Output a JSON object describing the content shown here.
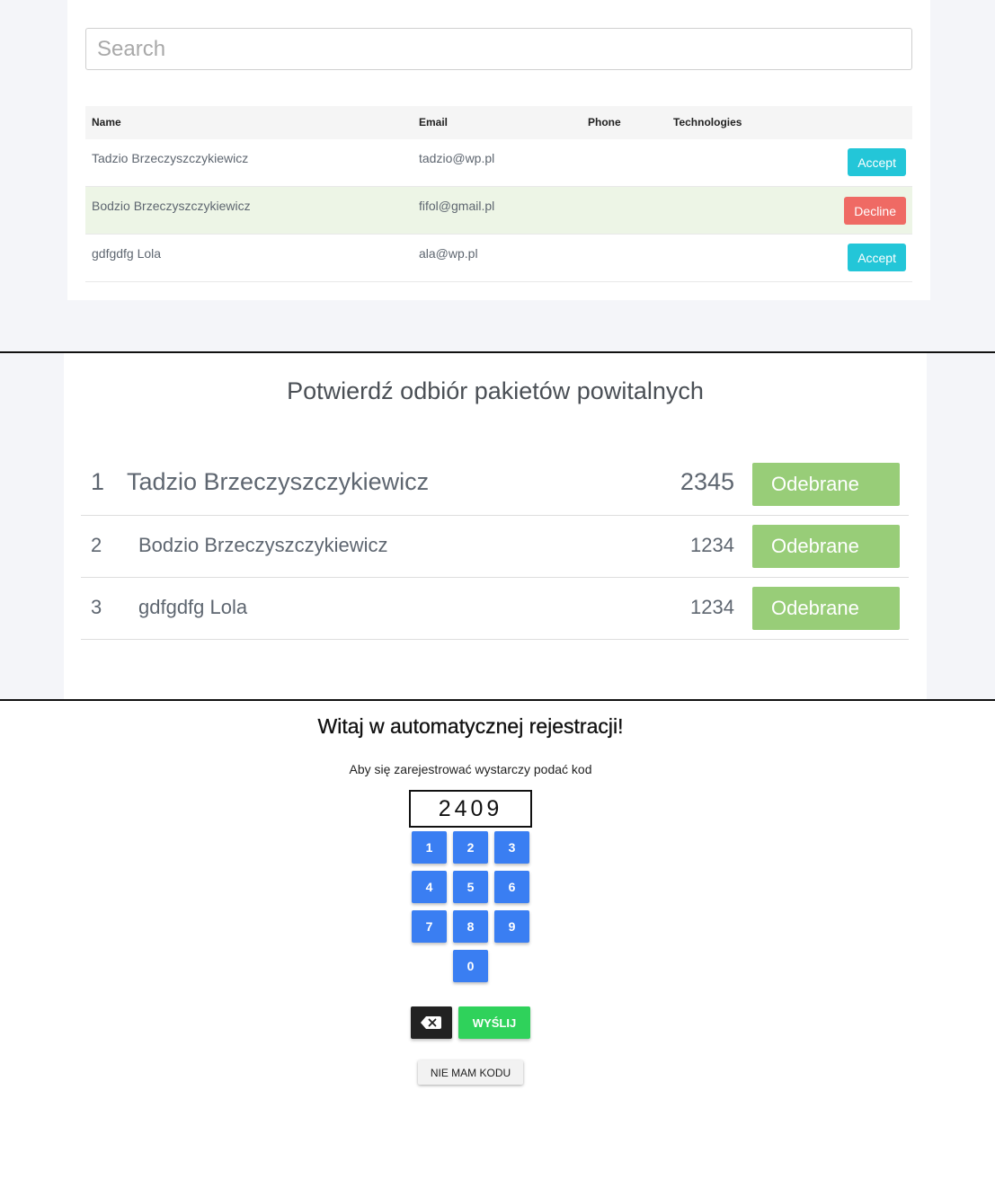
{
  "applicants": {
    "search_placeholder": "Search",
    "columns": [
      "Name",
      "Email",
      "Phone",
      "Technologies"
    ],
    "rows": [
      {
        "name": "Tadzio Brzeczyszczykiewicz",
        "email": "tadzio@wp.pl",
        "phone": "",
        "technologies": "",
        "action": "Accept"
      },
      {
        "name": "Bodzio Brzeczyszczykiewicz",
        "email": "fifol@gmail.pl",
        "phone": "",
        "technologies": "",
        "action": "Decline"
      },
      {
        "name": "gdfgdfg Lola",
        "email": "ala@wp.pl",
        "phone": "",
        "technologies": "",
        "action": "Accept"
      }
    ],
    "colors": {
      "accept": "#23c6d8",
      "decline": "#ef6a64",
      "highlight_row": "#edf5e6"
    }
  },
  "packages": {
    "title": "Potwierdź odbiór pakietów powitalnych",
    "rows": [
      {
        "num": "1",
        "name": "Tadzio Brzeczyszczykiewicz",
        "code": "2345",
        "button": "Odebrane"
      },
      {
        "num": "2",
        "name": "Bodzio Brzeczyszczykiewicz",
        "code": "1234",
        "button": "Odebrane"
      },
      {
        "num": "3",
        "name": "gdfgdfg Lola",
        "code": "1234",
        "button": "Odebrane"
      }
    ],
    "colors": {
      "button": "#98cd78"
    }
  },
  "registration": {
    "title": "Witaj w automatycznej rejestracji!",
    "subtitle": "Aby się zarejestrować wystarczy podać kod",
    "code_value": "2409",
    "keys": [
      "1",
      "2",
      "3",
      "4",
      "5",
      "6",
      "7",
      "8",
      "9",
      "0"
    ],
    "backspace_icon": "backspace-icon",
    "send_label": "WYŚLIJ",
    "no_code_label": "NIE MAM KODU",
    "colors": {
      "key": "#3a7ef2",
      "send": "#2fd25b",
      "backspace": "#222222"
    }
  }
}
